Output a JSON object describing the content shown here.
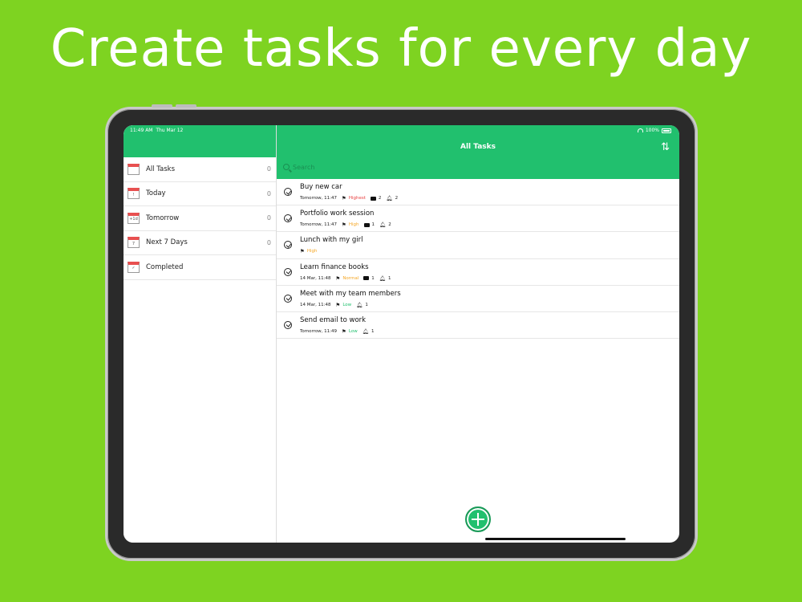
{
  "headline": "Create tasks for every day",
  "status": {
    "time": "11:49 AM",
    "date": "Thu Mar 12",
    "battery": "100%"
  },
  "colors": {
    "background": "#7ed321",
    "accent": "#21c06e",
    "highest": "#e84040",
    "high": "#f5a623",
    "normal": "#f5a623",
    "low": "#21c06e"
  },
  "sidebar": {
    "items": [
      {
        "label": "All Tasks",
        "count": "0",
        "icon": "calendar-all-icon",
        "icon_text": ""
      },
      {
        "label": "Today",
        "count": "0",
        "icon": "calendar-today-icon",
        "icon_text": "!"
      },
      {
        "label": "Tomorrow",
        "count": "0",
        "icon": "calendar-tomorrow-icon",
        "icon_text": "+1d"
      },
      {
        "label": "Next 7 Days",
        "count": "0",
        "icon": "calendar-week-icon",
        "icon_text": "7"
      },
      {
        "label": "Completed",
        "count": "",
        "icon": "calendar-completed-icon",
        "icon_text": "✓"
      }
    ]
  },
  "main": {
    "title": "All Tasks",
    "search_placeholder": "Search",
    "tasks": [
      {
        "title": "Buy new car",
        "date": "Tomorrow, 11:47",
        "priority": "Highest",
        "comments": "2",
        "reminders": "2"
      },
      {
        "title": "Portfolio work session",
        "date": "Tomorrow, 11:47",
        "priority": "High",
        "comments": "1",
        "reminders": "2"
      },
      {
        "title": "Lunch with my girl",
        "date": "",
        "priority": "High",
        "comments": "",
        "reminders": ""
      },
      {
        "title": "Learn finance books",
        "date": "14 Mar, 11:48",
        "priority": "Normal",
        "comments": "1",
        "reminders": "1"
      },
      {
        "title": "Meet with my team members",
        "date": "14 Mar, 11:48",
        "priority": "Low",
        "comments": "",
        "reminders": "1"
      },
      {
        "title": "Send email to work",
        "date": "Tomorrow, 11:49",
        "priority": "Low",
        "comments": "",
        "reminders": "1"
      }
    ]
  }
}
